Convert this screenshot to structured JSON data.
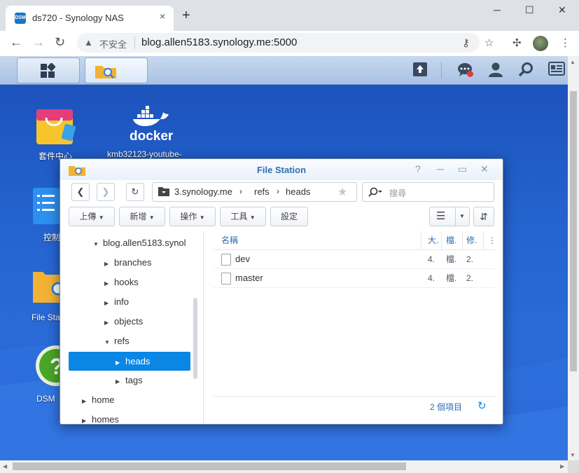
{
  "browser": {
    "tab_favicon": "DSM",
    "tab_title": "ds720 - Synology NAS",
    "tab_close": "×",
    "new_tab": "+",
    "window_minimize": "─",
    "window_maximize": "☐",
    "window_close": "✕",
    "insecure_label": "不安全",
    "url": "blog.allen5183.synology.me:5000"
  },
  "desktop": {
    "icons": [
      {
        "label": "套件中心"
      },
      {
        "label": "kmb32123-youtube-"
      },
      {
        "label": "控制"
      },
      {
        "label": "File Sta"
      },
      {
        "label": "DSM "
      }
    ],
    "docker_text": "docker"
  },
  "file_station": {
    "title": "File Station",
    "path_segments": [
      "3.synology.me",
      "refs",
      "heads"
    ],
    "search_placeholder": "搜尋",
    "actions": {
      "upload": "上傳",
      "create": "新增",
      "operate": "操作",
      "tools": "工具",
      "settings": "設定"
    },
    "tree": [
      {
        "label": "blog.allen5183.synol",
        "arrow": "▼"
      },
      {
        "label": "branches",
        "arrow": "▶"
      },
      {
        "label": "hooks",
        "arrow": "▶"
      },
      {
        "label": "info",
        "arrow": "▶"
      },
      {
        "label": "objects",
        "arrow": "▶"
      },
      {
        "label": "refs",
        "arrow": "▼"
      },
      {
        "label": "heads",
        "arrow": "▶"
      },
      {
        "label": "tags",
        "arrow": "▶"
      },
      {
        "label": "home",
        "arrow": "▶"
      },
      {
        "label": "homes",
        "arrow": "▶"
      }
    ],
    "columns": {
      "name": "名稱",
      "size": "大.",
      "type": "檔.",
      "modified": "修.",
      "more": "⋮"
    },
    "files": [
      {
        "name": "dev",
        "size": "4.",
        "type": "檔.",
        "modified": "2."
      },
      {
        "name": "master",
        "size": "4.",
        "type": "檔.",
        "modified": "2."
      }
    ],
    "status": "2 個項目"
  },
  "colors": {
    "accent": "#0a86e4",
    "title_blue": "#2f6fb5",
    "desktop_blue": "#2463cf"
  }
}
